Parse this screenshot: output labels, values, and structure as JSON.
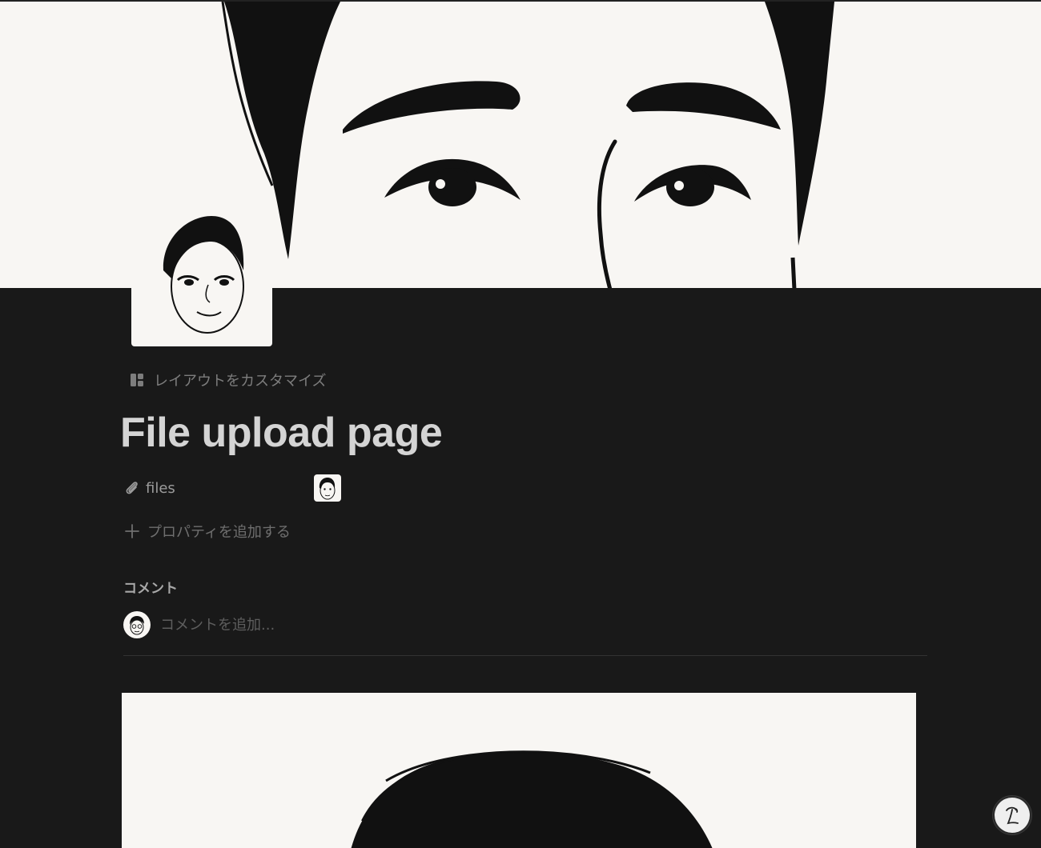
{
  "page": {
    "title": "File upload page",
    "customize_layout_label": "レイアウトをカスタマイズ"
  },
  "properties": [
    {
      "name": "files",
      "icon": "paperclip-icon",
      "value_type": "file-thumbnail"
    }
  ],
  "add_property_label": "プロパティを追加する",
  "comments": {
    "heading": "コメント",
    "placeholder": "コメントを追加..."
  },
  "icons": {
    "layout": "layout-icon",
    "paperclip": "paperclip-icon",
    "plus": "plus-icon",
    "help": "help-icon"
  },
  "colors": {
    "background": "#191919",
    "cover_background": "#f8f6f3",
    "title_text": "#d4d4d4",
    "muted_text": "#7d7d7d",
    "divider": "#333333"
  }
}
